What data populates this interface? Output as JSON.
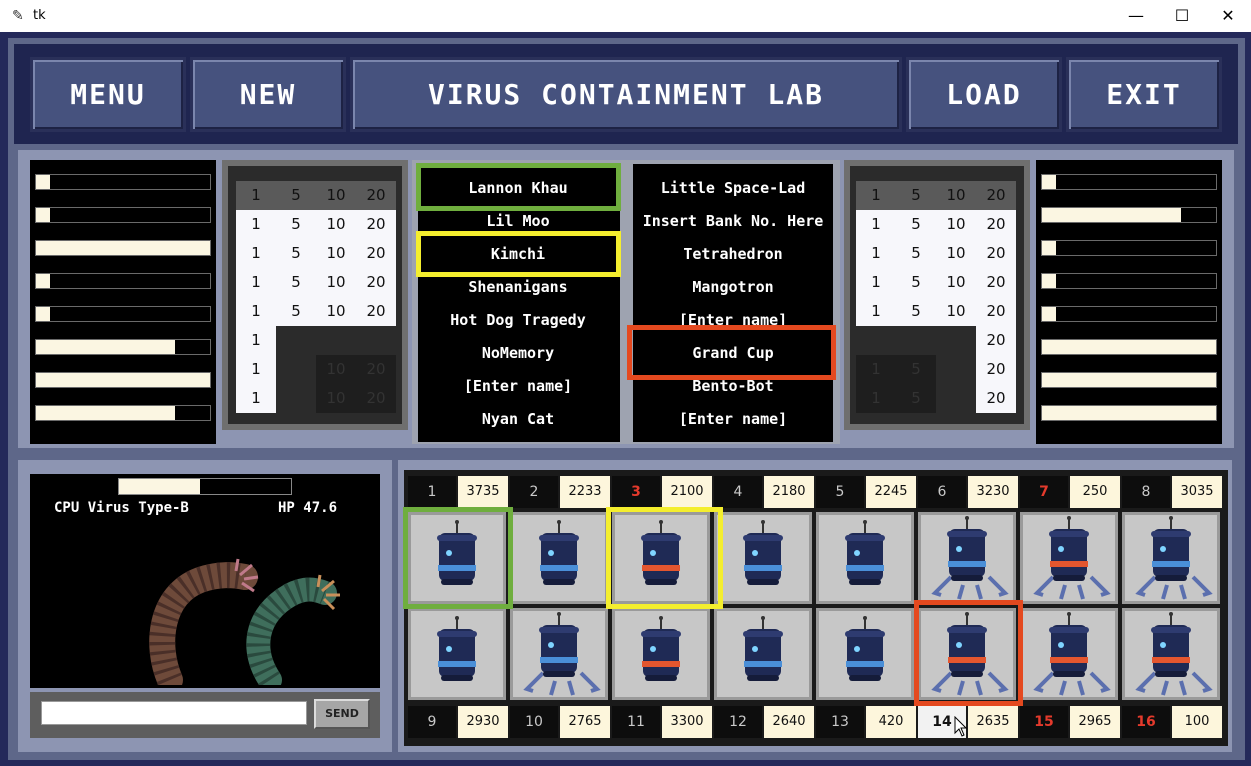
{
  "window": {
    "title": "tk",
    "minimize": "—",
    "maximize": "☐",
    "close": "✕"
  },
  "toolbar": {
    "menu": "MENU",
    "new": "NEW",
    "title": "VIRUS CONTAINMENT LAB",
    "load": "LOAD",
    "exit": "EXIT"
  },
  "left_bars": [
    0.08,
    0.08,
    1.0,
    0.08,
    0.08,
    0.8,
    1.0,
    0.8
  ],
  "right_bars": [
    0.08,
    0.8,
    0.08,
    0.08,
    0.08,
    1.0,
    1.0,
    1.0
  ],
  "left_table": {
    "header": [
      "1",
      "5",
      "10",
      "20"
    ],
    "rows": [
      [
        "1",
        "5",
        "10",
        "20"
      ],
      [
        "1",
        "5",
        "10",
        "20"
      ],
      [
        "1",
        "5",
        "10",
        "20"
      ],
      [
        "1",
        "5",
        "10",
        "20"
      ],
      [
        "1",
        "",
        "",
        ""
      ],
      [
        "1",
        "",
        "10",
        "20"
      ],
      [
        "1",
        "",
        "10",
        "20"
      ]
    ]
  },
  "right_table": {
    "header": [
      "1",
      "5",
      "10",
      "20"
    ],
    "rows": [
      [
        "1",
        "5",
        "10",
        "20"
      ],
      [
        "1",
        "5",
        "10",
        "20"
      ],
      [
        "1",
        "5",
        "10",
        "20"
      ],
      [
        "1",
        "5",
        "10",
        "20"
      ],
      [
        "",
        "",
        "",
        "20"
      ],
      [
        "1",
        "5",
        "",
        "20"
      ],
      [
        "1",
        "5",
        "",
        "20"
      ]
    ]
  },
  "left_names": [
    "Lannon Khau",
    "Lil Moo",
    "Kimchi",
    "Shenanigans",
    "Hot Dog Tragedy",
    "NoMemory",
    "[Enter name]",
    "Nyan Cat"
  ],
  "right_names": [
    "Little Space-Lad",
    "Insert Bank No. Here",
    "Tetrahedron",
    "Mangotron",
    "[Enter name]",
    "Grand Cup",
    "Bento-Bot",
    "[Enter name]"
  ],
  "virus": {
    "name": "CPU Virus Type-B",
    "hp": "HP 47.6",
    "hp_fraction": 0.47
  },
  "chat": {
    "input_value": "",
    "send": "SEND"
  },
  "slots_top": [
    {
      "num": "1",
      "score": "3735",
      "red": false
    },
    {
      "num": "2",
      "score": "2233",
      "red": false
    },
    {
      "num": "3",
      "score": "2100",
      "red": true
    },
    {
      "num": "4",
      "score": "2180",
      "red": false
    },
    {
      "num": "5",
      "score": "2245",
      "red": false
    },
    {
      "num": "6",
      "score": "3230",
      "red": false
    },
    {
      "num": "7",
      "score": "250",
      "red": true
    },
    {
      "num": "8",
      "score": "3035",
      "red": false
    }
  ],
  "slots_bottom": [
    {
      "num": "9",
      "score": "2930",
      "red": false
    },
    {
      "num": "10",
      "score": "2765",
      "red": false
    },
    {
      "num": "11",
      "score": "3300",
      "red": false
    },
    {
      "num": "12",
      "score": "2640",
      "red": false
    },
    {
      "num": "13",
      "score": "420",
      "red": false
    },
    {
      "num": "14",
      "score": "2635",
      "red": false
    },
    {
      "num": "15",
      "score": "2965",
      "red": true
    },
    {
      "num": "16",
      "score": "100",
      "red": true
    }
  ],
  "robots_top": [
    {
      "band": "blue",
      "legs": false
    },
    {
      "band": "blue",
      "legs": false
    },
    {
      "band": "orange",
      "legs": false
    },
    {
      "band": "blue",
      "legs": false
    },
    {
      "band": "blue",
      "legs": false
    },
    {
      "band": "blue",
      "legs": true
    },
    {
      "band": "orange",
      "legs": true
    },
    {
      "band": "blue",
      "legs": true
    }
  ],
  "robots_bottom": [
    {
      "band": "blue",
      "legs": false
    },
    {
      "band": "blue",
      "legs": true
    },
    {
      "band": "orange",
      "legs": false
    },
    {
      "band": "blue",
      "legs": false
    },
    {
      "band": "blue",
      "legs": false
    },
    {
      "band": "orange",
      "legs": true
    },
    {
      "band": "orange",
      "legs": true
    },
    {
      "band": "orange",
      "legs": true
    }
  ],
  "colors": {
    "blue_band": "#4a8fd8",
    "orange_band": "#e4562f",
    "robot_body": "#1f2a55"
  }
}
